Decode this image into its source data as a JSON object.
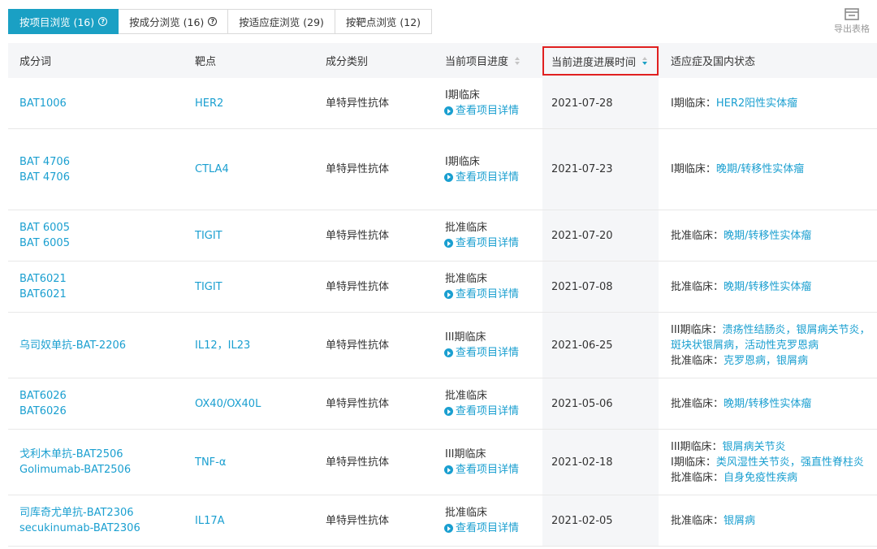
{
  "tabs": [
    {
      "label": "按项目浏览 (16)",
      "active": true,
      "help": true
    },
    {
      "label": "按成分浏览 (16)",
      "active": false,
      "help": true
    },
    {
      "label": "按适应症浏览 (29)",
      "active": false,
      "help": false
    },
    {
      "label": "按靶点浏览 (12)",
      "active": false,
      "help": false
    }
  ],
  "export_label": "导出表格",
  "headers": {
    "ingredient": "成分词",
    "target": "靶点",
    "category": "成分类别",
    "progress": "当前项目进度",
    "progress_time": "当前进度进展时间",
    "indication": "适应症及国内状态"
  },
  "detail_label": "查看项目详情",
  "rows": [
    {
      "names": [
        "BAT1006"
      ],
      "target": "HER2",
      "category": "单特异性抗体",
      "progress": "I期临床",
      "date": "2021-07-28",
      "indications": [
        {
          "stage": "I期临床：",
          "items": "HER2阳性实体瘤"
        }
      ]
    },
    {
      "names": [
        "BAT 4706",
        "BAT 4706"
      ],
      "target": "CTLA4",
      "category": "单特异性抗体",
      "progress": "I期临床",
      "date": "2021-07-23",
      "indications": [
        {
          "stage": "I期临床：",
          "items": "晚期/转移性实体瘤"
        }
      ]
    },
    {
      "names": [
        "BAT 6005",
        "BAT 6005"
      ],
      "target": "TIGIT",
      "category": "单特异性抗体",
      "progress": "批准临床",
      "date": "2021-07-20",
      "indications": [
        {
          "stage": "批准临床：",
          "items": "晚期/转移性实体瘤"
        }
      ]
    },
    {
      "names": [
        "BAT6021",
        "BAT6021"
      ],
      "target": "TIGIT",
      "category": "单特异性抗体",
      "progress": "批准临床",
      "date": "2021-07-08",
      "indications": [
        {
          "stage": "批准临床：",
          "items": "晚期/转移性实体瘤"
        }
      ]
    },
    {
      "names": [
        "乌司奴单抗-BAT-2206"
      ],
      "target": "IL12，IL23",
      "category": "单特异性抗体",
      "progress": "III期临床",
      "date": "2021-06-25",
      "indications": [
        {
          "stage": "III期临床：",
          "items": "溃疡性结肠炎，银屑病关节炎，"
        },
        {
          "stage": "",
          "items": "斑块状银屑病，活动性克罗恩病"
        },
        {
          "stage": "批准临床：",
          "items": "克罗恩病，银屑病"
        }
      ]
    },
    {
      "names": [
        "BAT6026",
        "BAT6026"
      ],
      "target": "OX40/OX40L",
      "category": "单特异性抗体",
      "progress": "批准临床",
      "date": "2021-05-06",
      "indications": [
        {
          "stage": "批准临床：",
          "items": "晚期/转移性实体瘤"
        }
      ]
    },
    {
      "names": [
        "戈利木单抗-BAT2506",
        "Golimumab-BAT2506"
      ],
      "target": "TNF-α",
      "category": "单特异性抗体",
      "progress": "III期临床",
      "date": "2021-02-18",
      "indications": [
        {
          "stage": "III期临床：",
          "items": "银屑病关节炎"
        },
        {
          "stage": "I期临床：",
          "items": "类风湿性关节炎，强直性脊柱炎"
        },
        {
          "stage": "批准临床：",
          "items": "自身免疫性疾病"
        }
      ]
    },
    {
      "names": [
        "司库奇尤单抗-BAT2306",
        "secukinumab-BAT2306"
      ],
      "target": "IL17A",
      "category": "单特异性抗体",
      "progress": "批准临床",
      "date": "2021-02-05",
      "indications": [
        {
          "stage": "批准临床：",
          "items": "银屑病"
        }
      ]
    }
  ],
  "colors": {
    "accent": "#1aa0c4",
    "link": "#1a9fd0",
    "highlight_border": "#e02020",
    "header_bg": "#f5f6f8"
  }
}
